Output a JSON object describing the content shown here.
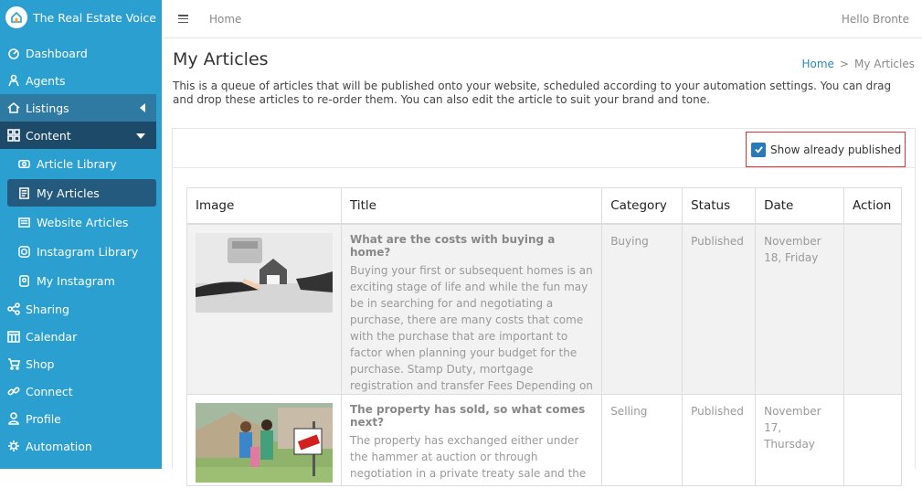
{
  "brand": {
    "name": "The Real Estate Voice"
  },
  "sidebar": {
    "items": [
      {
        "label": "Dashboard",
        "icon": "dashboard-icon"
      },
      {
        "label": "Agents",
        "icon": "agents-icon"
      },
      {
        "label": "Listings",
        "icon": "listings-icon"
      },
      {
        "label": "Content",
        "icon": "content-icon"
      },
      {
        "label": "Sharing",
        "icon": "share-icon"
      },
      {
        "label": "Calendar",
        "icon": "calendar-icon"
      },
      {
        "label": "Shop",
        "icon": "cart-icon"
      },
      {
        "label": "Connect",
        "icon": "link-icon"
      },
      {
        "label": "Profile",
        "icon": "user-icon"
      },
      {
        "label": "Automation",
        "icon": "gear-icon"
      }
    ],
    "content_sub": [
      {
        "label": "Article Library",
        "icon": "article-library-icon"
      },
      {
        "label": "My Articles",
        "icon": "my-articles-icon"
      },
      {
        "label": "Website Articles",
        "icon": "website-articles-icon"
      },
      {
        "label": "Instagram Library",
        "icon": "instagram-icon"
      },
      {
        "label": "My Instagram",
        "icon": "my-instagram-icon"
      }
    ]
  },
  "topbar": {
    "home": "Home",
    "greeting": "Hello Bronte"
  },
  "page": {
    "title": "My Articles",
    "breadcrumb": {
      "home": "Home",
      "sep": ">",
      "current": "My Articles"
    },
    "description": "This is a queue of articles that will be published onto your website, scheduled according to your automation settings. You can drag and drop these articles to re-order them. You can also edit the article to suit your brand and tone."
  },
  "filter": {
    "label": "Show already published",
    "checked": true
  },
  "table": {
    "headers": [
      "Image",
      "Title",
      "Category",
      "Status",
      "Date",
      "Action"
    ],
    "rows": [
      {
        "title": "What are the costs with buying a home?",
        "body": "Buying your first or subsequent homes is an exciting stage of life and while the fun may be in searching for and negotiating a purchase, there are many costs that come with the purchase that are important to factor when planning your budget for the purchase. Stamp Duty, mortgage registration and transfer Fees Depending on",
        "category": "Buying",
        "status": "Published",
        "date": "November 18, Friday"
      },
      {
        "title": "The property has sold, so what comes next?",
        "body": "The property has exchanged either under the hammer at auction or through negotiation in a private treaty sale and the",
        "category": "Selling",
        "status": "Published",
        "date": "November 17, Thursday"
      }
    ]
  },
  "colors": {
    "sidebar": "#2a9fd0",
    "sidebar_active": "#1c4a68",
    "accent": "#2a7ab8",
    "highlight_border": "#dd3333"
  }
}
